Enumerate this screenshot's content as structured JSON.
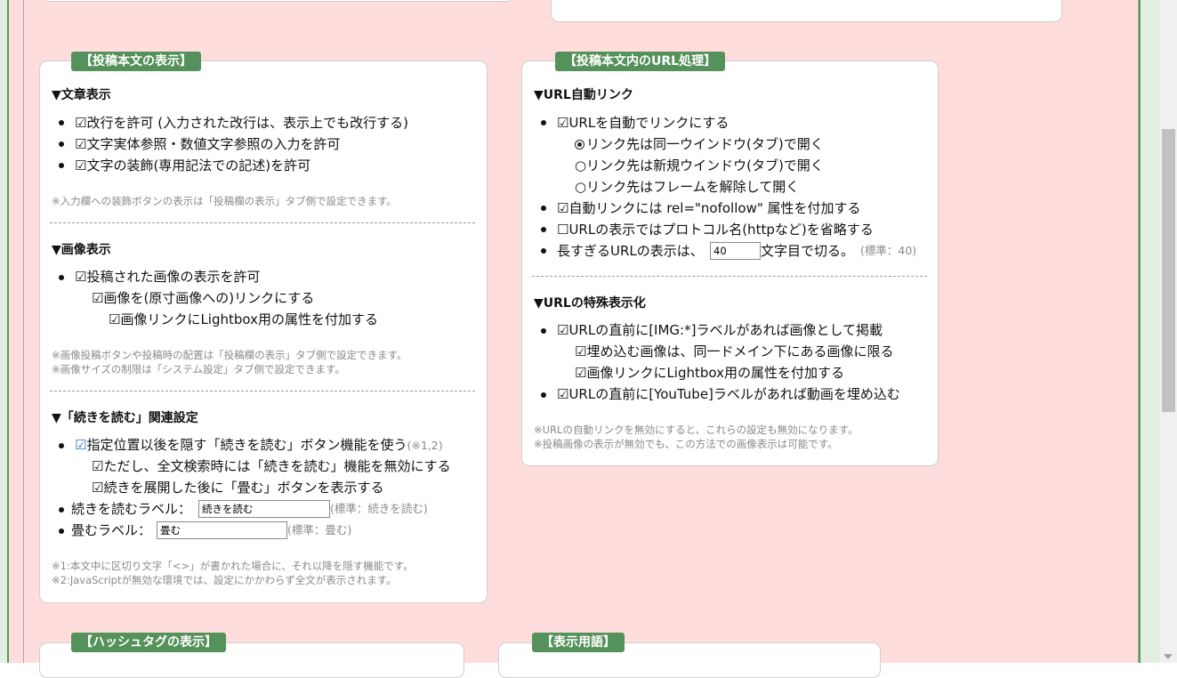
{
  "post_body": {
    "title": "【投稿本文の表示】",
    "text_section": {
      "heading": "▼文章表示",
      "items": [
        "☑改行を許可 (入力された改行は、表示上でも改行する)",
        "☑文字実体参照・数値文字参照の入力を許可",
        "☑文字の装飾(専用記法での記述)を許可"
      ],
      "note": "※入力欄への装飾ボタンの表示は「投稿欄の表示」タブ側で設定できます。"
    },
    "image_section": {
      "heading": "▼画像表示",
      "item": "☑投稿された画像の表示を許可",
      "sub1": "☑画像を(原寸画像への)リンクにする",
      "sub2": "☑画像リンクにLightbox用の属性を付加する",
      "note1": "※画像投稿ボタンや投稿時の配置は「投稿欄の表示」タブ側で設定できます。",
      "note2": "※画像サイズの制限は「システム設定」タブ側で設定できます。"
    },
    "readmore_section": {
      "heading": "▼「続きを読む」関連設定",
      "check": "☑",
      "item": "指定位置以後を隠す「続きを読む」ボタン機能を使う",
      "item_note": "(※1,2)",
      "sub1": "☑ただし、全文検索時には「続きを読む」機能を無効にする",
      "sub2": "☑続きを展開した後に「畳む」ボタンを表示する",
      "label_more": "続きを読むラベル：",
      "label_more_value": "続きを読む",
      "label_more_std": "(標準：続きを読む)",
      "label_fold": "畳むラベル：",
      "label_fold_value": "畳む",
      "label_fold_std": "(標準：畳む)",
      "note1": "※1:本文中に区切り文字「<>」が書かれた場合に、それ以降を隠す機能です。",
      "note2": "※2:JavaScriptが無効な環境では、設定にかかわらず全文が表示されます。"
    }
  },
  "url_processing": {
    "title": "【投稿本文内のURL処理】",
    "autolink_section": {
      "heading": "▼URL自動リンク",
      "item1": "☑URLを自動でリンクにする",
      "radio1": "リンク先は同一ウインドウ(タブ)で開く",
      "radio2": "○リンク先は新規ウインドウ(タブ)で開く",
      "radio3": "○リンク先はフレームを解除して開く",
      "item2": "☑自動リンクには rel=\"nofollow\" 属性を付加する",
      "item3": "☐URLの表示ではプロトコル名(httpなど)を省略する",
      "item4_pre": "長すぎるURLの表示は、",
      "item4_value": "40",
      "item4_post": "文字目で切る。",
      "item4_std": "(標準：40)"
    },
    "special_section": {
      "heading": "▼URLの特殊表示化",
      "item1": "☑URLの直前に[IMG:*]ラベルがあれば画像として掲載",
      "sub1": "☑埋め込む画像は、同一ドメイン下にある画像に限る",
      "sub2": "☑画像リンクにLightbox用の属性を付加する",
      "item2": "☑URLの直前に[YouTube]ラベルがあれば動画を埋め込む",
      "note1": "※URLの自動リンクを無効にすると、これらの設定も無効になります。",
      "note2": "※投稿画像の表示が無効でも、この方法での画像表示は可能です。"
    }
  },
  "hashtag": {
    "title": "【ハッシュタグの表示】"
  },
  "terms": {
    "title": "【表示用語】"
  },
  "colors": {
    "accent": "#55915a",
    "background": "#ffdddd",
    "panel": "#ffffff",
    "note": "#8a8a8a"
  }
}
